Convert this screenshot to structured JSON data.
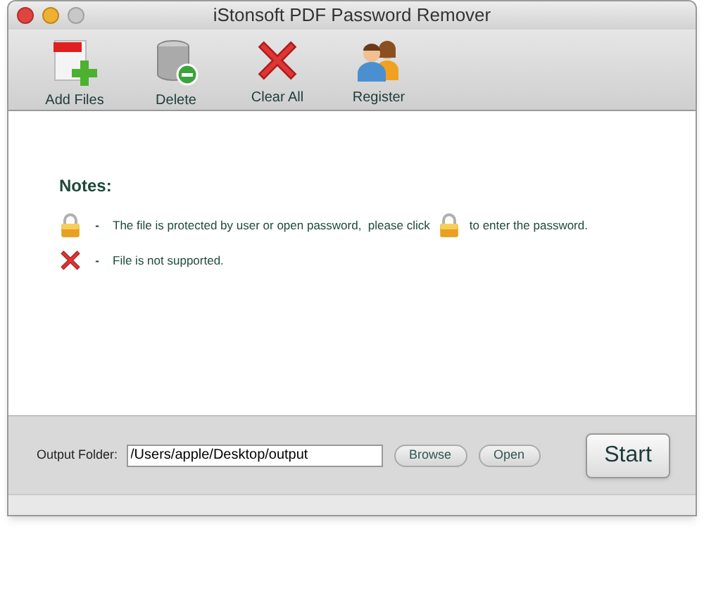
{
  "window": {
    "title": "iStonsoft PDF Password Remover"
  },
  "toolbar": [
    {
      "kind": "add",
      "label": "Add Files"
    },
    {
      "kind": "delete",
      "label": "Delete"
    },
    {
      "kind": "clear",
      "label": "Clear All"
    },
    {
      "kind": "register",
      "label": "Register"
    }
  ],
  "notes": {
    "heading": "Notes:",
    "items": [
      {
        "kind": "lock",
        "dash": "-",
        "text": "The file is protected by user or open password,  please click",
        "after": "to enter the password."
      },
      {
        "kind": "cross",
        "dash": "-",
        "text": "File is not supported."
      }
    ]
  },
  "output": {
    "label": "Output Folder:",
    "value": "/Users/apple/Desktop/output",
    "buttons": [
      "Browse",
      "Open"
    ],
    "start": "Start"
  }
}
